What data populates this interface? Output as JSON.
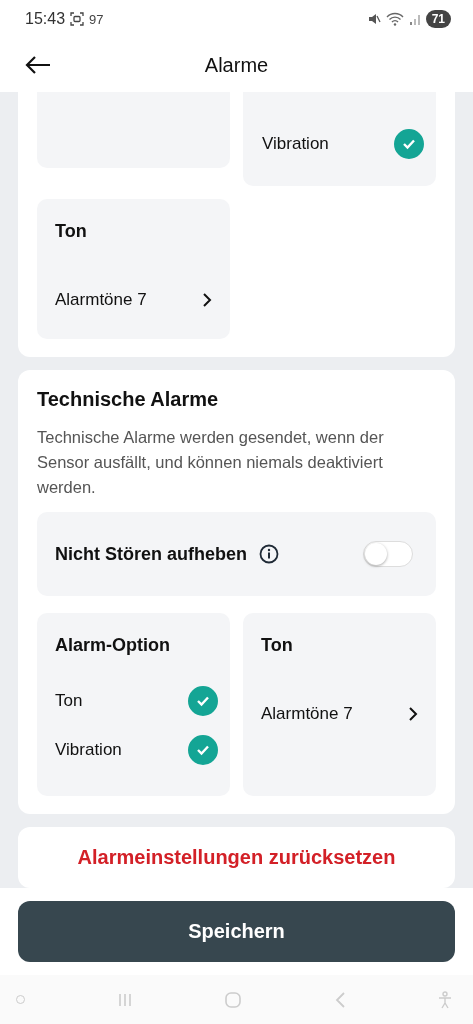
{
  "status_bar": {
    "time": "15:43",
    "notification_count": "97",
    "battery": "71"
  },
  "header": {
    "title": "Alarme"
  },
  "alarm_card": {
    "option_tile": {
      "options": [
        {
          "label": "Vibration",
          "checked": true
        }
      ]
    },
    "sound_tile": {
      "title": "Ton",
      "value": "Alarmtöne 7"
    }
  },
  "technical_alarms": {
    "title": "Technische Alarme",
    "description": "Technische Alarme werden gesendet, wenn der Sensor ausfällt, und können niemals deaktiviert werden.",
    "dnd_override": {
      "label": "Nicht Stören aufheben",
      "on": false
    },
    "option_tile": {
      "title": "Alarm-Option",
      "options": [
        {
          "label": "Ton",
          "checked": true
        },
        {
          "label": "Vibration",
          "checked": true
        }
      ]
    },
    "sound_tile": {
      "title": "Ton",
      "value": "Alarmtöne 7"
    }
  },
  "reset_button": "Alarmeinstellungen zurücksetzen",
  "save_button": "Speichern"
}
